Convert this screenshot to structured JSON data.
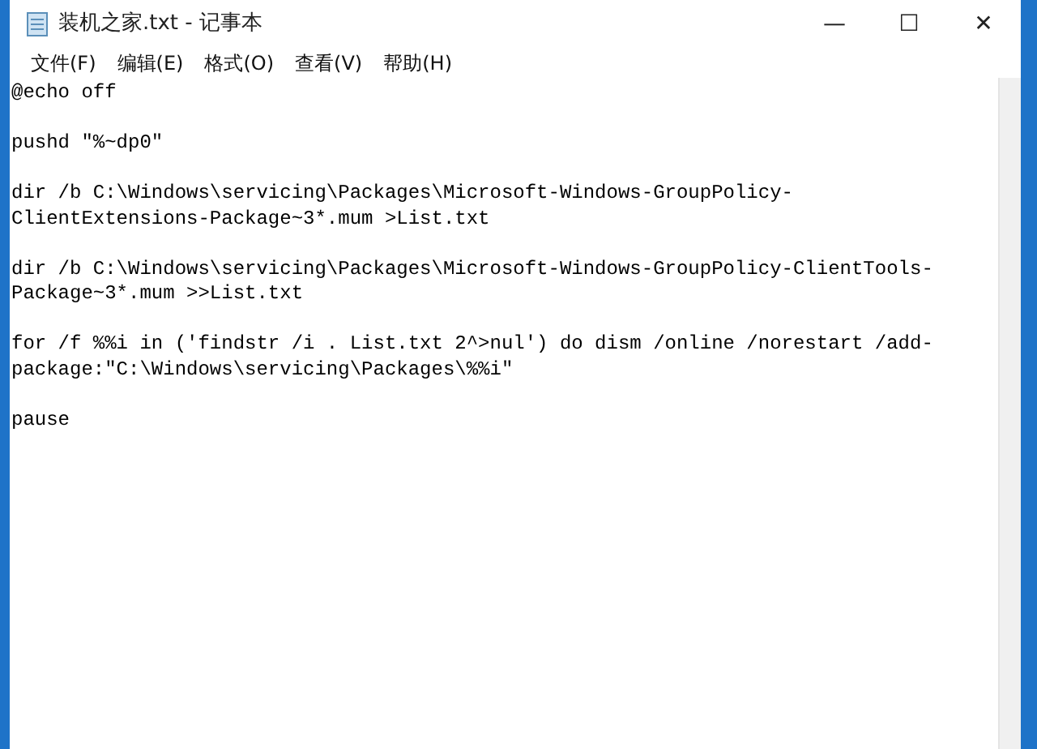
{
  "window": {
    "title": "装机之家.txt - 记事本",
    "controls": [
      "—",
      "☐",
      "✕"
    ]
  },
  "menu": [
    {
      "label": "文件(F)"
    },
    {
      "label": "编辑(E)"
    },
    {
      "label": "格式(O)"
    },
    {
      "label": "查看(V)"
    },
    {
      "label": "帮助(H)"
    }
  ],
  "document": {
    "paragraphs": [
      {
        "lines": [
          "@echo off"
        ]
      },
      {
        "lines": [
          "pushd ″%~dp0″"
        ]
      },
      {
        "lines": [
          "dir /b C:\\Windows\\servicing\\Packages\\Microsoft-Windows-GroupPolicy-",
          "ClientExtensions-Package~3*.mum >List.txt"
        ]
      },
      {
        "lines": [
          "dir /b C:\\Windows\\servicing\\Packages\\Microsoft-Windows-GroupPolicy-ClientTools-",
          "Package~3*.mum >>List.txt"
        ]
      },
      {
        "lines": [
          "for /f %%i in ('findstr /i . List.txt 2^>nul') do dism /online /norestart /add-",
          "package:″C:\\Windows\\servicing\\Packages\\%%i″"
        ]
      },
      {
        "lines": [
          "pause"
        ]
      }
    ]
  }
}
